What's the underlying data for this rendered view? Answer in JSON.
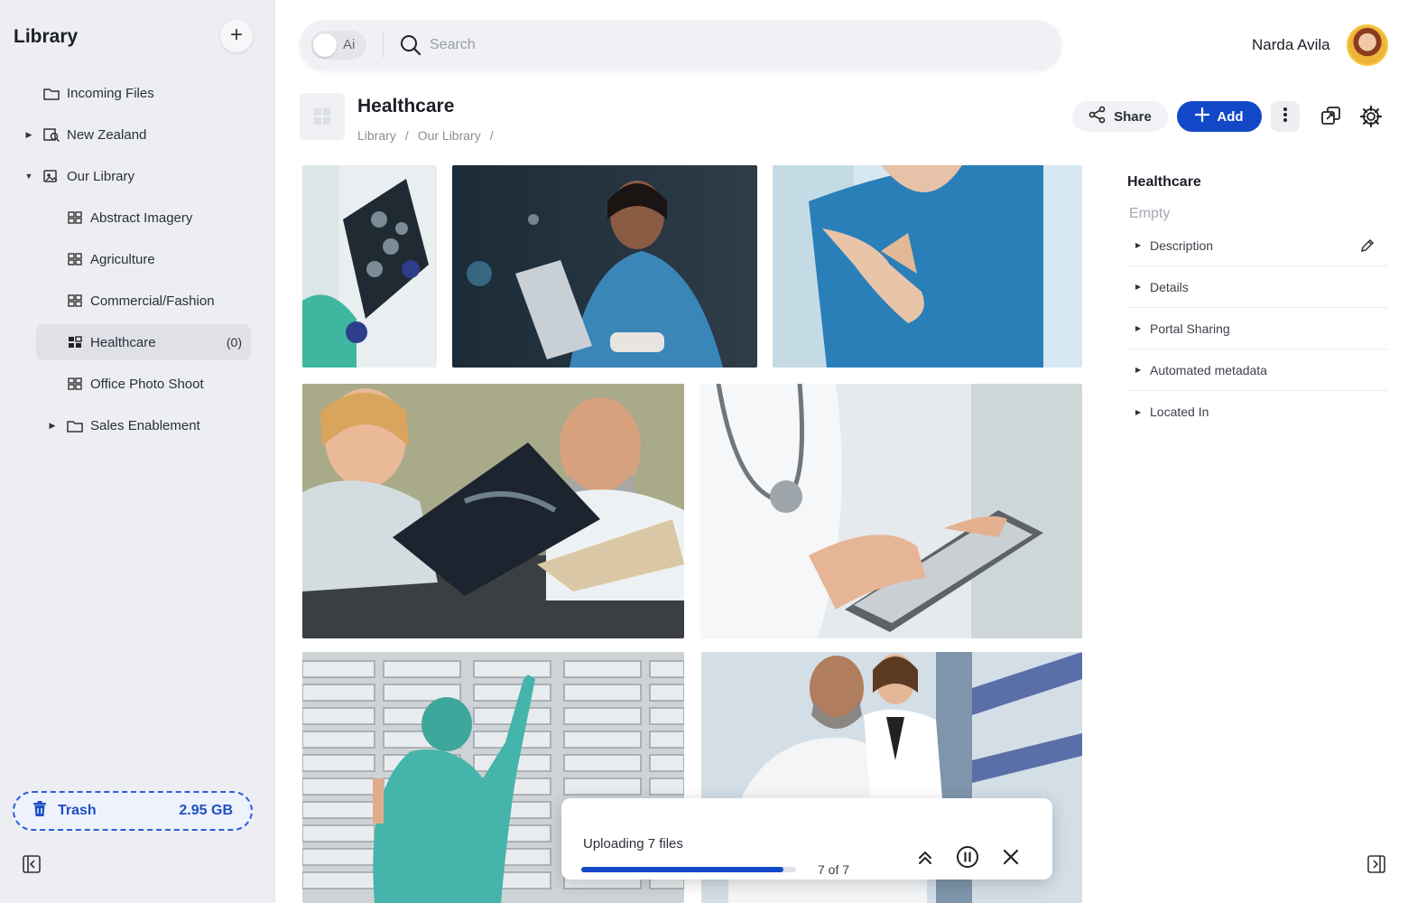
{
  "sidebar": {
    "title": "Library",
    "items": [
      {
        "label": "Incoming Files",
        "count": ""
      },
      {
        "label": "New Zealand",
        "count": ""
      },
      {
        "label": "Our Library",
        "count": ""
      },
      {
        "label": "Abstract Imagery",
        "count": ""
      },
      {
        "label": "Agriculture",
        "count": ""
      },
      {
        "label": "Commercial/Fashion",
        "count": ""
      },
      {
        "label": "Healthcare",
        "count": "(0)"
      },
      {
        "label": "Office Photo Shoot",
        "count": ""
      },
      {
        "label": "Sales Enablement",
        "count": ""
      }
    ],
    "trash": {
      "label": "Trash",
      "size": "2.95 GB"
    }
  },
  "topbar": {
    "ai_label": "Ai",
    "search_placeholder": "Search",
    "user_name": "Narda Avila"
  },
  "header": {
    "title": "Healthcare",
    "breadcrumb": [
      "Library",
      "/",
      "Our Library",
      "/"
    ],
    "share_label": "Share",
    "add_label": "Add"
  },
  "panel": {
    "title": "Healthcare",
    "status": "Empty",
    "sections": [
      "Description",
      "Details",
      "Portal Sharing",
      "Automated metadata",
      "Located In"
    ]
  },
  "upload": {
    "label": "Uploading 7 files",
    "count": "7 of 7",
    "progress": 0.94
  },
  "colors": {
    "accent": "#1248c7",
    "sidebar_bg": "#eceef2"
  }
}
